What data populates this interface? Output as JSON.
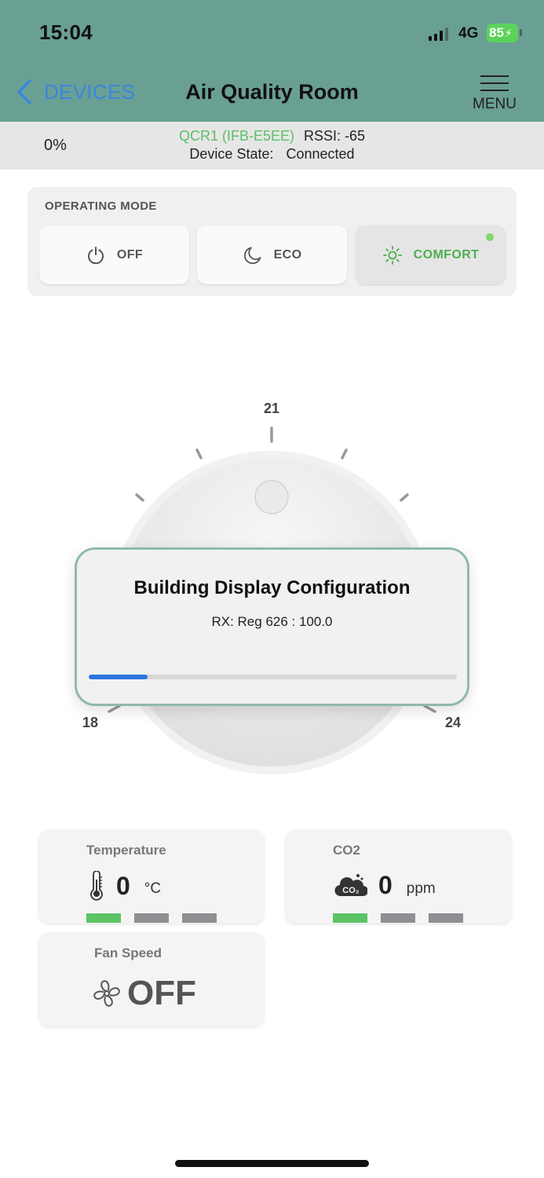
{
  "status_bar": {
    "time": "15:04",
    "network": "4G",
    "battery": "85"
  },
  "nav": {
    "back_label": "DEVICES",
    "title": "Air Quality Room",
    "menu_label": "MENU"
  },
  "device": {
    "percent": "0%",
    "name": "QCR1 (IFB-E5EE)",
    "rssi": "RSSI: -65",
    "state_label": "Device State:",
    "state_value": "Connected"
  },
  "operating_mode": {
    "title": "OPERATING MODE",
    "modes": [
      {
        "label": "OFF",
        "icon": "power-icon",
        "active": false
      },
      {
        "label": "ECO",
        "icon": "moon-icon",
        "active": false
      },
      {
        "label": "COMFORT",
        "icon": "sun-icon",
        "active": true
      }
    ]
  },
  "dial": {
    "scale_min": "18",
    "scale_mid": "21",
    "scale_max": "24"
  },
  "modal": {
    "title": "Building Display Configuration",
    "message": "RX: Reg 626 : 100.0",
    "progress": 0.16
  },
  "sensors": {
    "temperature": {
      "title": "Temperature",
      "value": "0",
      "unit": "°C",
      "icon": "thermometer-icon",
      "level": 1
    },
    "co2": {
      "title": "CO2",
      "value": "0",
      "unit": "ppm",
      "icon": "co2-cloud-icon",
      "level": 1
    },
    "fan": {
      "title": "Fan Speed",
      "value": "OFF",
      "icon": "fan-icon"
    }
  },
  "colors": {
    "header": "#6a9f94",
    "accent_blue": "#3a86e0",
    "active_green": "#4caf50",
    "level_on": "#5cc466",
    "level_off": "#8e8e93"
  }
}
